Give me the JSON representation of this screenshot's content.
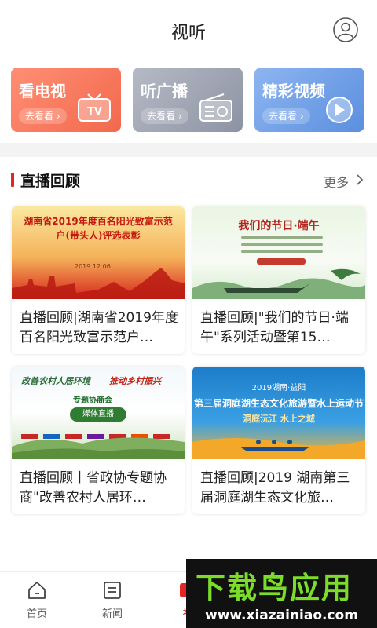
{
  "header": {
    "title": "视听"
  },
  "categories": [
    {
      "title": "看电视",
      "action": "去看看 ›"
    },
    {
      "title": "听广播",
      "action": "去看看 ›"
    },
    {
      "title": "精彩视频",
      "action": "去看看 ›"
    }
  ],
  "section": {
    "title": "直播回顾",
    "more": "更多"
  },
  "cards": [
    {
      "title": "直播回顾|湖南省2019年度百名阳光致富示范户…",
      "thumb": {
        "headline": "湖南省2019年度百名阳光致富示范户(带头人)评选表彰",
        "date": "2019.12.06"
      }
    },
    {
      "title": "直播回顾|\"我们的节日·端午\"系列活动暨第15…",
      "thumb": {
        "headline": "我们的节日·端午"
      }
    },
    {
      "title": "直播回顾丨省政协专题协商\"改善农村人居环…",
      "thumb": {
        "headline_left": "改善农村人居环境",
        "headline_right": "推动乡村振兴",
        "subtitle": "专题协商会",
        "badge": "媒体直播"
      }
    },
    {
      "title": "直播回顾|2019 湖南第三届洞庭湖生态文化旅…",
      "thumb": {
        "line1": "2019湖南·益阳",
        "line2": "第三届洞庭湖生态文化旅游暨水上运动节",
        "line3": "洞庭沅江 水上之城"
      }
    }
  ],
  "tabbar": [
    {
      "label": "首页"
    },
    {
      "label": "新闻"
    },
    {
      "label": "视"
    }
  ],
  "watermark": {
    "brand": "下载鸟应用",
    "url": "www.xiazainiao.com"
  },
  "colors": {
    "accent": "#e52525",
    "tv": "#f2694d",
    "radio": "#8d93a3",
    "video": "#5b8fdf"
  }
}
